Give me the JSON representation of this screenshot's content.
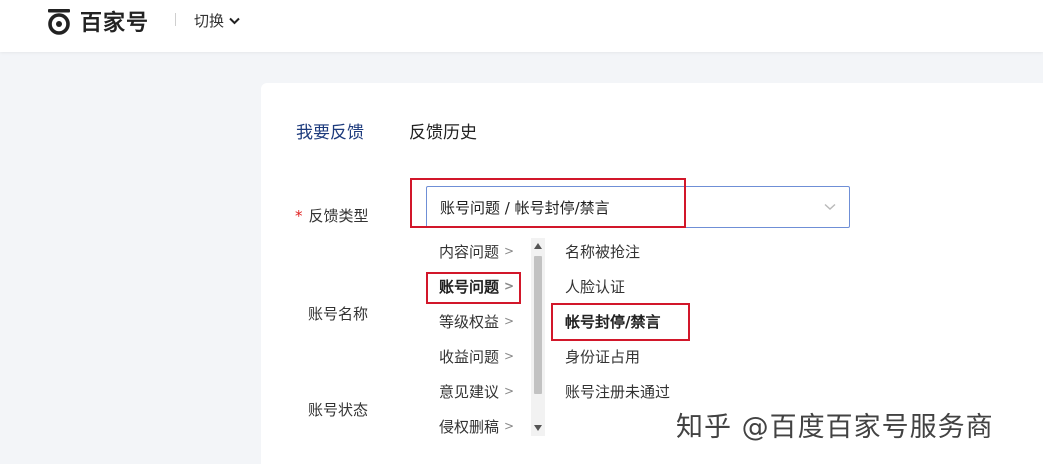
{
  "header": {
    "logo_text": "百家号",
    "switch_label": "切换"
  },
  "tabs": [
    {
      "label": "我要反馈",
      "active": true
    },
    {
      "label": "反馈历史",
      "active": false
    }
  ],
  "form": {
    "feedback_type": {
      "required_mark": "*",
      "label": "反馈类型",
      "value": "账号问题 / 帐号封停/禁言"
    },
    "account_name_label": "账号名称",
    "account_status_label": "账号状态"
  },
  "dropdown": {
    "categories": [
      {
        "label": "内容问题",
        "chevron": ">",
        "selected": false
      },
      {
        "label": "账号问题",
        "chevron": ">",
        "selected": true
      },
      {
        "label": "等级权益",
        "chevron": ">",
        "selected": false
      },
      {
        "label": "收益问题",
        "chevron": ">",
        "selected": false
      },
      {
        "label": "意见建议",
        "chevron": ">",
        "selected": false
      },
      {
        "label": "侵权删稿",
        "chevron": ">",
        "selected": false
      }
    ],
    "subcategories": [
      {
        "label": "名称被抢注",
        "selected": false
      },
      {
        "label": "人脸认证",
        "selected": false
      },
      {
        "label": "帐号封停/禁言",
        "selected": true
      },
      {
        "label": "身份证占用",
        "selected": false
      },
      {
        "label": "账号注册未通过",
        "selected": false
      }
    ]
  },
  "watermark": "知乎 @百度百家号服务商",
  "colors": {
    "highlight_box": "#d2172a",
    "active_tab": "#1d3b7d",
    "select_border": "#6f8fd6",
    "page_bg": "#f3f5f8"
  }
}
